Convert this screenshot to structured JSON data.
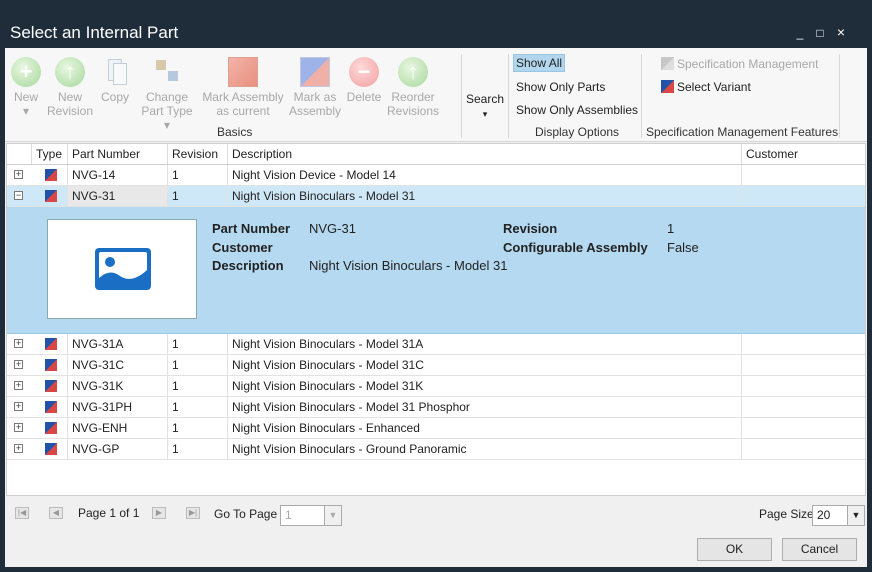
{
  "window": {
    "title": "Select an Internal Part",
    "minimize": "_",
    "maximize": "□",
    "close": "×"
  },
  "ribbon": {
    "basics": {
      "label": "Basics",
      "buttons": [
        {
          "label": "New",
          "sub": "▾"
        },
        {
          "label": "New",
          "sub": "Revision"
        },
        {
          "label": "Copy",
          "sub": ""
        },
        {
          "label": "Change",
          "sub": "Part Type ▾"
        },
        {
          "label": "Mark Assembly",
          "sub": "as current"
        },
        {
          "label": "Mark as",
          "sub": "Assembly"
        },
        {
          "label": "Delete",
          "sub": ""
        },
        {
          "label": "Reorder",
          "sub": "Revisions"
        }
      ]
    },
    "search": {
      "label": "Search",
      "sub": "▾"
    },
    "display": {
      "label": "Display Options",
      "show_all": "Show All",
      "only_parts": "Show Only Parts",
      "only_assemblies": "Show Only Assemblies"
    },
    "spec": {
      "label": "Specification Management Features",
      "management": "Specification Management",
      "select_variant": "Select Variant"
    }
  },
  "grid": {
    "columns": [
      "Type",
      "Part Number",
      "Revision",
      "Description",
      "Customer"
    ],
    "rows": [
      {
        "expander": "+",
        "part": "NVG-14",
        "rev": "1",
        "desc": "Night Vision Device - Model 14",
        "customer": ""
      },
      {
        "expander": "−",
        "part": "NVG-31",
        "rev": "1",
        "desc": "Night Vision Binoculars - Model 31",
        "customer": ""
      },
      {
        "expander": "+",
        "part": "NVG-31A",
        "rev": "1",
        "desc": "Night Vision Binoculars - Model 31A",
        "customer": ""
      },
      {
        "expander": "+",
        "part": "NVG-31C",
        "rev": "1",
        "desc": "Night Vision Binoculars - Model 31C",
        "customer": ""
      },
      {
        "expander": "+",
        "part": "NVG-31K",
        "rev": "1",
        "desc": "Night Vision Binoculars - Model 31K",
        "customer": ""
      },
      {
        "expander": "+",
        "part": "NVG-31PH",
        "rev": "1",
        "desc": "Night Vision Binoculars - Model 31 Phosphor",
        "customer": ""
      },
      {
        "expander": "+",
        "part": "NVG-ENH",
        "rev": "1",
        "desc": "Night Vision Binoculars - Enhanced",
        "customer": ""
      },
      {
        "expander": "+",
        "part": "NVG-GP",
        "rev": "1",
        "desc": "Night Vision Binoculars - Ground Panoramic",
        "customer": ""
      }
    ],
    "detail": {
      "part_label": "Part Number",
      "part_value": "NVG-31",
      "customer_label": "Customer",
      "customer_value": "",
      "description_label": "Description",
      "description_value": "Night Vision Binoculars - Model 31",
      "revision_label": "Revision",
      "revision_value": "1",
      "configurable_label": "Configurable Assembly",
      "configurable_value": "False"
    }
  },
  "pager": {
    "page_text": "Page 1 of 1",
    "goto_label": "Go To Page",
    "goto_value": "1",
    "size_label": "Page Size",
    "size_value": "20"
  },
  "footer": {
    "ok": "OK",
    "cancel": "Cancel"
  },
  "colors": {
    "titlebar": "#1f2d3b",
    "selected_row": "#b5d9f0",
    "accent_blue": "#1a6fc4"
  }
}
